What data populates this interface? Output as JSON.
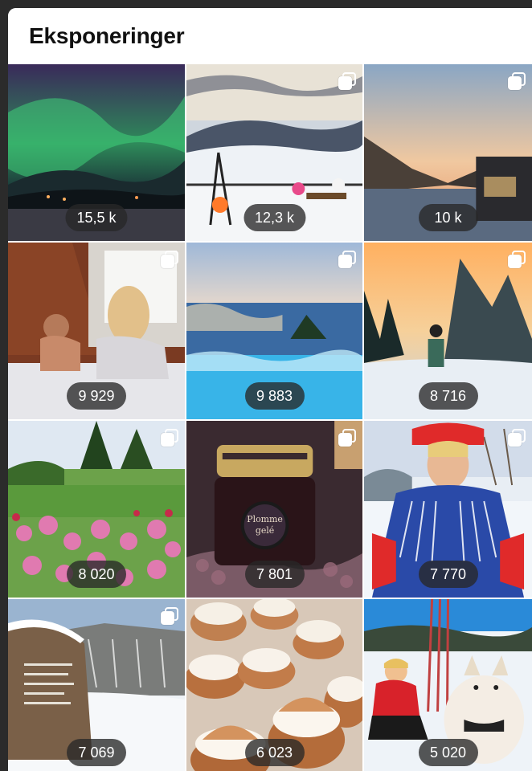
{
  "header": {
    "title": "Eksponeringer"
  },
  "tiles": [
    {
      "name": "aurora",
      "count": "15,5 k",
      "multi": false
    },
    {
      "name": "winter-firepit",
      "count": "12,3 k",
      "multi": true
    },
    {
      "name": "fjord-sunset",
      "count": "10 k",
      "multi": true
    },
    {
      "name": "couple-bed",
      "count": "9 929",
      "multi": true
    },
    {
      "name": "infinity-pool",
      "count": "9 883",
      "multi": true
    },
    {
      "name": "skier-sunset",
      "count": "8 716",
      "multi": true
    },
    {
      "name": "flower-garden",
      "count": "8 020",
      "multi": true
    },
    {
      "name": "plum-jam",
      "count": "7 801",
      "multi": true
    },
    {
      "name": "sami-costume",
      "count": "7 770",
      "multi": true
    },
    {
      "name": "snow-monument",
      "count": "7 069",
      "multi": true
    },
    {
      "name": "cream-buns",
      "count": "6 023",
      "multi": false
    },
    {
      "name": "girl-husky",
      "count": "5 020",
      "multi": false
    }
  ],
  "jar_label": {
    "line1": "Plomme",
    "line2": "gelé"
  }
}
